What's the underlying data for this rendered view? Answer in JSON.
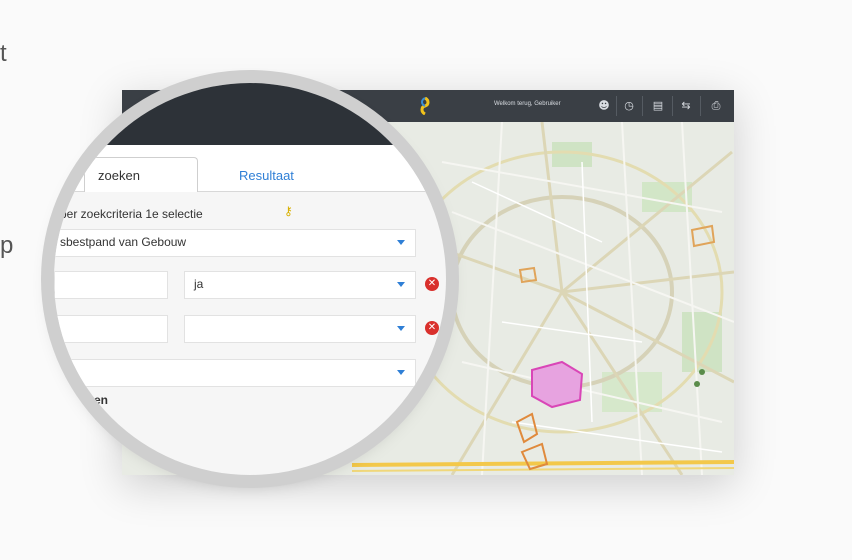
{
  "edge_texts": {
    "t": "t",
    "p": "p"
  },
  "topbar": {
    "user_name": "Welkom terug, Gebruiker",
    "icons": [
      "user-icon",
      "clock-icon",
      "map-icon",
      "share-icon",
      "print-icon"
    ]
  },
  "panel": {
    "tab_search": "zoeken",
    "tab_result": "Resultaat",
    "criteria_label": "ber zoekcriteria 1e selectie",
    "object_select": "sbestpand van Gebouw",
    "row1_value": "ja",
    "row2_value": "",
    "row3_value": "",
    "footer_label": "en"
  },
  "colors": {
    "topbar": "#3a3f45",
    "accent": "#2f7fd6",
    "remove": "#d9302c",
    "key": "#d8b000",
    "highlight": "#d946b7"
  }
}
